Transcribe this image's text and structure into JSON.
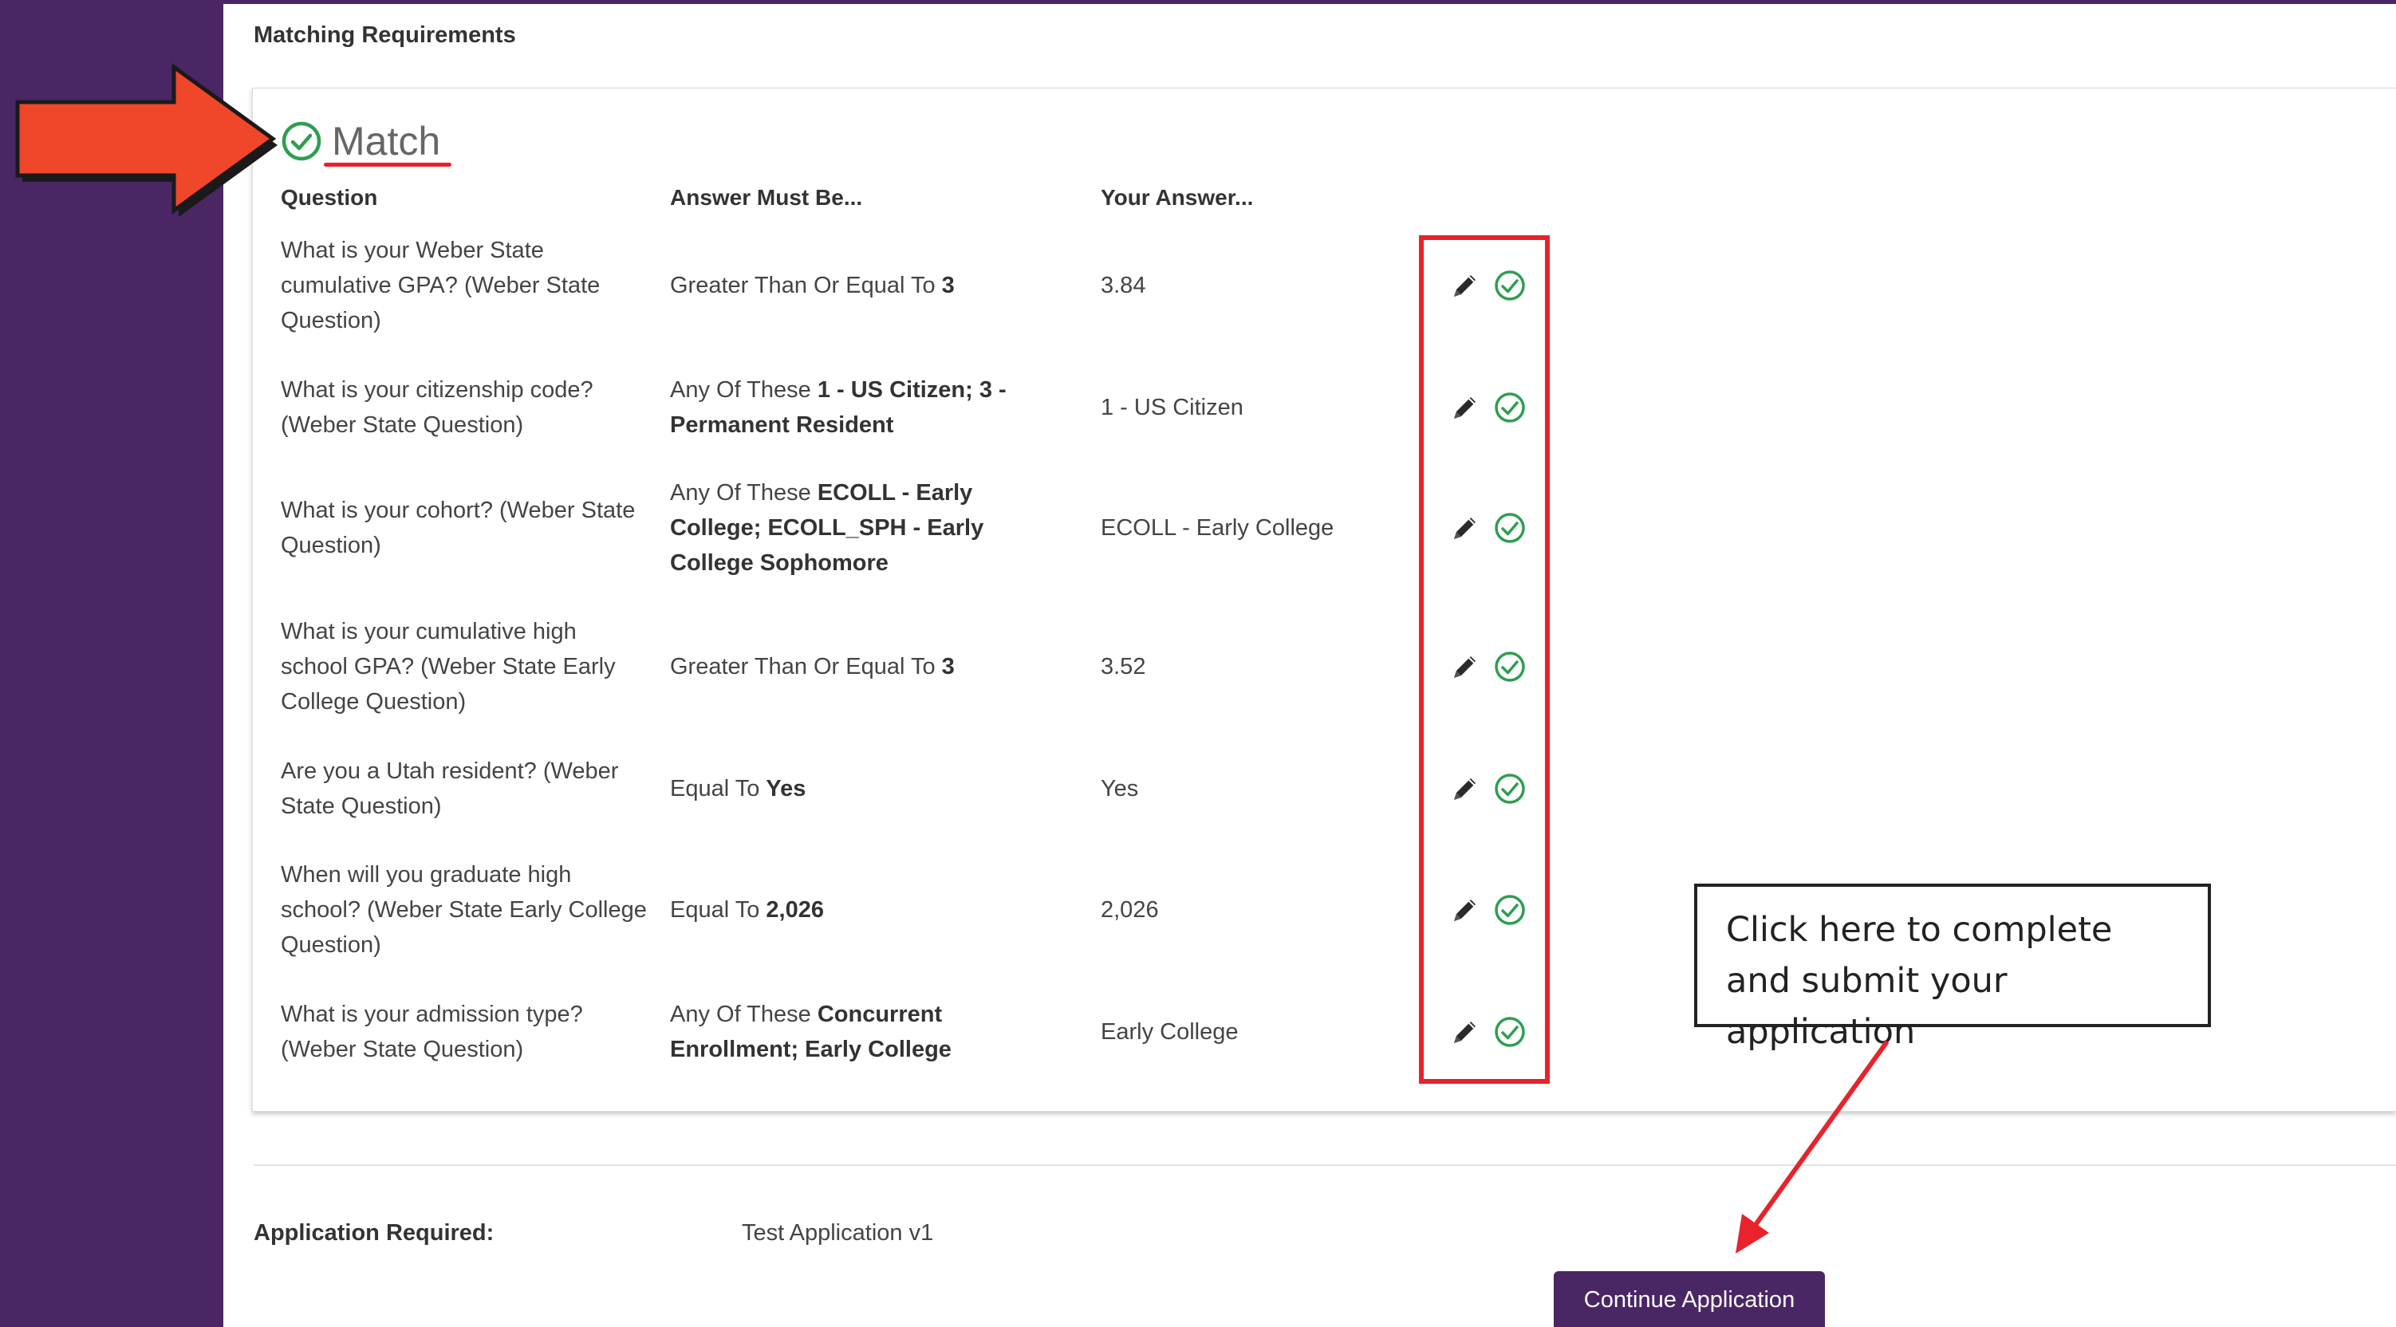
{
  "section": {
    "title": "Matching Requirements"
  },
  "match": {
    "label": "Match"
  },
  "columns": {
    "question": "Question",
    "answer_must_be": "Answer Must Be...",
    "your_answer": "Your Answer..."
  },
  "rows": [
    {
      "question": "What is your Weber State cumulative GPA? (Weber State Question)",
      "rule": "Greater Than Or Equal To",
      "rule_value": "3",
      "answer": "3.84"
    },
    {
      "question": "What is your citizenship code? (Weber State Question)",
      "rule": "Any Of These",
      "rule_value": "1 - US Citizen; 3 - Permanent Resident",
      "answer": "1 - US Citizen"
    },
    {
      "question": "What is your cohort? (Weber State Question)",
      "rule": "Any Of These",
      "rule_value": "ECOLL - Early College; ECOLL_SPH - Early College Sophomore",
      "answer": "ECOLL - Early College"
    },
    {
      "question": "What is your cumulative high school GPA? (Weber State Early College Question)",
      "rule": "Greater Than Or Equal To",
      "rule_value": "3",
      "answer": "3.52"
    },
    {
      "question": "Are you a Utah resident? (Weber State Question)",
      "rule": "Equal To",
      "rule_value": "Yes",
      "answer": "Yes"
    },
    {
      "question": "When will you graduate high school? (Weber State Early College Question)",
      "rule": "Equal To",
      "rule_value": "2,026",
      "answer": "2,026"
    },
    {
      "question": "What is your admission type? (Weber State Question)",
      "rule": "Any Of These",
      "rule_value": "Concurrent Enrollment; Early College",
      "answer": "Early College"
    }
  ],
  "application": {
    "label": "Application Required:",
    "value": "Test Application v1",
    "continue_label": "Continue Application"
  },
  "callout": {
    "text": "Click here to complete and submit your application"
  },
  "icons": {
    "edit": "pencil-icon",
    "status": "check-circle-icon",
    "arrow": "red-arrow-icon"
  },
  "colors": {
    "brand_purple": "#4a2665",
    "success_green": "#2e9e4f",
    "annotation_red": "#e8232b",
    "arrow_orange": "#f0462a"
  }
}
